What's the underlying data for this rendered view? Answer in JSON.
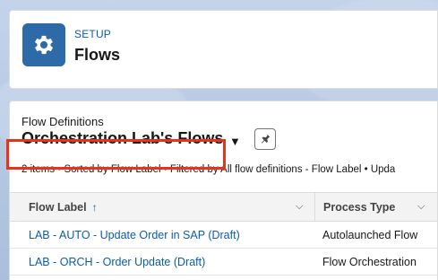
{
  "header": {
    "eyebrow": "SETUP",
    "title": "Flows",
    "icon": "gear-icon",
    "icon_bg_color": "#2e6aa8"
  },
  "list_view": {
    "eyebrow": "Flow Definitions",
    "title": "Orchestration Lab's Flows",
    "meta": "2 items • Sorted by Flow Label • Filtered by All flow definitions - Flow Label • Upda"
  },
  "table": {
    "columns": [
      {
        "label": "Flow Label",
        "sort_indicator": "↑"
      },
      {
        "label": "Process Type"
      }
    ],
    "rows": [
      {
        "flow_label": "LAB - AUTO - Update Order in SAP (Draft)",
        "process_type": "Autolaunched Flow"
      },
      {
        "flow_label": "LAB - ORCH - Order Update (Draft)",
        "process_type": "Flow Orchestration",
        "highlighted": true
      }
    ]
  },
  "colors": {
    "link": "#0b5cab",
    "highlight": "#e8321d"
  }
}
